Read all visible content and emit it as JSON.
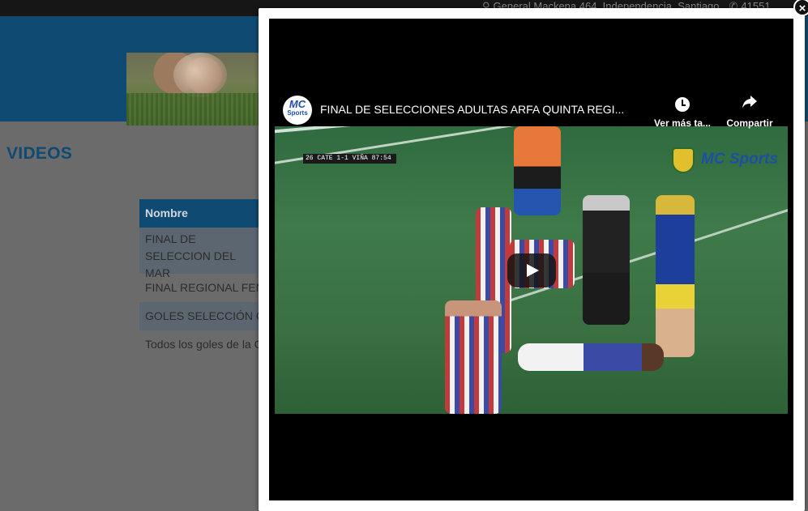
{
  "topbar": {
    "address": "General Mackena 464, Independencia, Santiago",
    "phone": "41551"
  },
  "page": {
    "title": "VIDEOS"
  },
  "table": {
    "header": "Nombre",
    "rows": [
      "FINAL DE SELECCION DEL MAR",
      "FINAL REGIONAL FEN",
      "GOLES SELECCIÓN C",
      "Todos los goles de la C"
    ]
  },
  "modal": {
    "close_label": "×",
    "video": {
      "title": "FINAL DE SELECCIONES ADULTAS ARFA QUINTA REGI...",
      "channel_logo_line1": "MC",
      "channel_logo_line2": "Sports",
      "watch_later_label": "Ver más ta...",
      "share_label": "Compartir",
      "scorebug": "26 CATE 1-1 VIÑA 87:54",
      "brand": "MC Sports"
    }
  },
  "colors": {
    "header_blue": "#0f4a73",
    "overlay_gray": "#6b6b6b"
  },
  "icons": [
    "map-pin-icon",
    "phone-icon",
    "clock-icon",
    "share-icon",
    "play-icon",
    "close-icon"
  ]
}
